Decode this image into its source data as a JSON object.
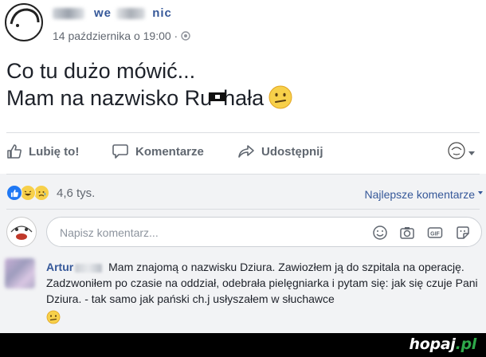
{
  "post": {
    "author_visible_fragment": "we",
    "author_fragment_end": "nic",
    "date": "14 października o 19:00 ·",
    "text_line1": "Co tu dużo mówić...",
    "text_line2_start": "Mam na nazwisko Ru",
    "text_line2_end": "hała",
    "emoji": "confused-face-emoji"
  },
  "actions": {
    "like_label": "Lubię to!",
    "comment_label": "Komentarze",
    "share_label": "Udostępnij"
  },
  "reactions": {
    "count": "4,6 tys.",
    "types": [
      "like",
      "haha",
      "sad"
    ],
    "sort_label": "Najlepsze komentarze"
  },
  "comment_input": {
    "placeholder": "Napisz komentarz..."
  },
  "reply": {
    "author": "Artur",
    "text": "Mam znajomą o nazwisku Dziura. Zawiozłem ją do szpitala na operację. Zadzwoniłem po czasie na oddział, odebrała pielęgniarka i pytam się: jak się czuje Pani Dziura. - tak samo jak pański ch.j usłyszałem w słuchawce",
    "emoji": "confused-face-emoji"
  },
  "watermark": {
    "main": "hopaj",
    "suffix": ".pl"
  },
  "colors": {
    "link": "#365899",
    "muted": "#606770",
    "background_comments": "#f2f3f5",
    "brand_green": "#2ea84a"
  }
}
